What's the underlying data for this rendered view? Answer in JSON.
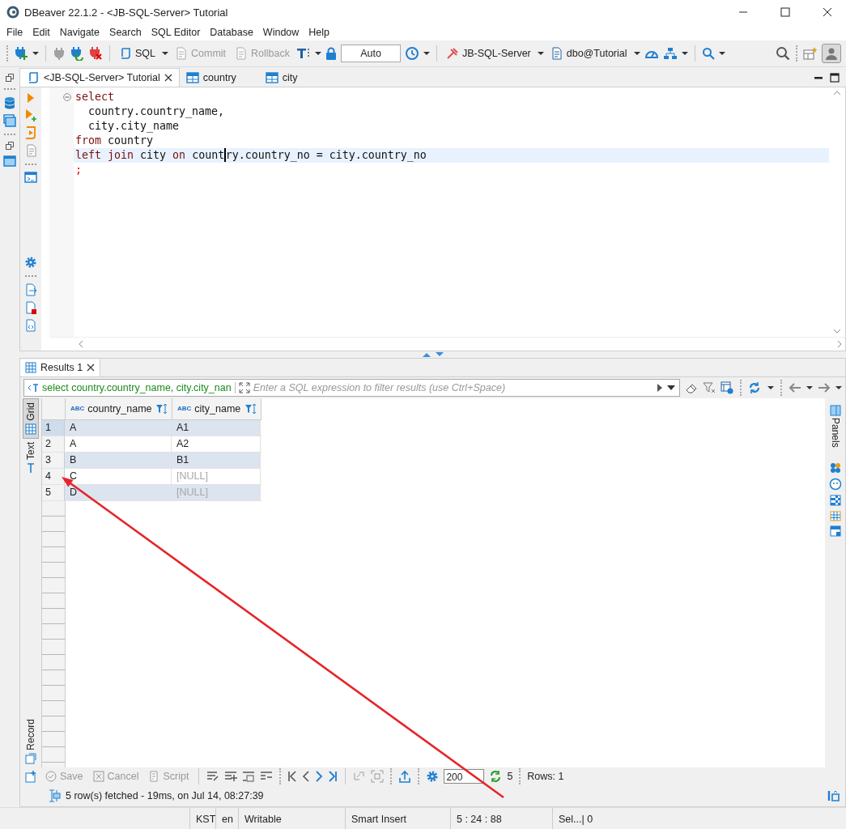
{
  "window": {
    "title": "DBeaver 22.1.2 - <JB-SQL-Server> Tutorial"
  },
  "menu": [
    "File",
    "Edit",
    "Navigate",
    "Search",
    "SQL Editor",
    "Database",
    "Window",
    "Help"
  ],
  "toolbar": {
    "sql_button": {
      "label": "SQL"
    },
    "commit": {
      "label": "Commit",
      "disabled": true
    },
    "rollback": {
      "label": "Rollback",
      "disabled": true
    },
    "transaction_mode": {
      "value": "Auto"
    },
    "connection": {
      "label": "JB-SQL-Server"
    },
    "schema": {
      "label": "dbo@Tutorial"
    }
  },
  "editor_tabs": [
    {
      "label": "<JB-SQL-Server> Tutorial",
      "kind": "script",
      "selected": true
    },
    {
      "label": "country",
      "kind": "table",
      "selected": false
    },
    {
      "label": "city",
      "kind": "table",
      "selected": false
    }
  ],
  "editor": {
    "lines": [
      {
        "current": false,
        "foldable": true,
        "tokens": [
          {
            "text": "select",
            "kind": "keyword"
          }
        ]
      },
      {
        "current": false,
        "foldable": false,
        "tokens": [
          {
            "text": "  country.country_name,",
            "kind": "plain"
          }
        ]
      },
      {
        "current": false,
        "foldable": false,
        "tokens": [
          {
            "text": "  city.city_name",
            "kind": "plain"
          }
        ]
      },
      {
        "current": false,
        "foldable": false,
        "tokens": [
          {
            "text": "from",
            "kind": "keyword"
          },
          {
            "text": " country",
            "kind": "plain"
          }
        ]
      },
      {
        "current": true,
        "foldable": false,
        "tokens": [
          {
            "text": "left join",
            "kind": "keyword"
          },
          {
            "text": " city ",
            "kind": "plain"
          },
          {
            "text": "on",
            "kind": "keyword"
          },
          {
            "text": " count",
            "kind": "plain",
            "caret": true
          },
          {
            "text": "ry.country_no = city.country_no",
            "kind": "plain"
          }
        ]
      },
      {
        "current": false,
        "foldable": false,
        "tokens": [
          {
            "text": ";",
            "kind": "terminator"
          }
        ]
      }
    ]
  },
  "results_tabs": [
    {
      "label": "Results 1",
      "selected": true
    }
  ],
  "filter": {
    "query": "select country.country_name, city.city_nan",
    "placeholder": "Enter a SQL expression to filter results (use Ctrl+Space)"
  },
  "view_tabs": [
    {
      "label": "Grid",
      "selected": true
    },
    {
      "label": "Text",
      "selected": false
    },
    {
      "label": "Record",
      "selected": false
    }
  ],
  "table": {
    "columns": [
      {
        "type_label": "ABC",
        "name": "country_name"
      },
      {
        "type_label": "ABC",
        "name": "city_name"
      }
    ],
    "rows": [
      {
        "number": "1",
        "selected": true,
        "cells": [
          {
            "value": "A",
            "null": false
          },
          {
            "value": "A1",
            "null": false
          }
        ]
      },
      {
        "number": "2",
        "selected": false,
        "cells": [
          {
            "value": "A",
            "null": false
          },
          {
            "value": "A2",
            "null": false
          }
        ]
      },
      {
        "number": "3",
        "selected": false,
        "cells": [
          {
            "value": "B",
            "null": false
          },
          {
            "value": "B1",
            "null": false
          }
        ]
      },
      {
        "number": "4",
        "selected": false,
        "cells": [
          {
            "value": "C",
            "null": false
          },
          {
            "value": "[NULL]",
            "null": true
          }
        ]
      },
      {
        "number": "5",
        "selected": false,
        "cells": [
          {
            "value": "D",
            "null": false
          },
          {
            "value": "[NULL]",
            "null": true
          }
        ]
      }
    ]
  },
  "side_panel": {
    "label": "Panels"
  },
  "results_toolbar": {
    "save": {
      "label": "Save",
      "disabled": true
    },
    "cancel": {
      "label": "Cancel",
      "disabled": true
    },
    "script": {
      "label": "Script",
      "disabled": true
    },
    "fetch_size": "200",
    "fetched_count": "5",
    "rows": "Rows: 1"
  },
  "status": "5 row(s) fetched - 19ms, on Jul 14, 08:27:39",
  "status_bar": [
    "KST",
    "en",
    "Writable",
    "Smart Insert",
    "5 : 24 : 88",
    "Sel...| 0"
  ],
  "annotations": [
    {
      "kind": "arrow"
    }
  ]
}
